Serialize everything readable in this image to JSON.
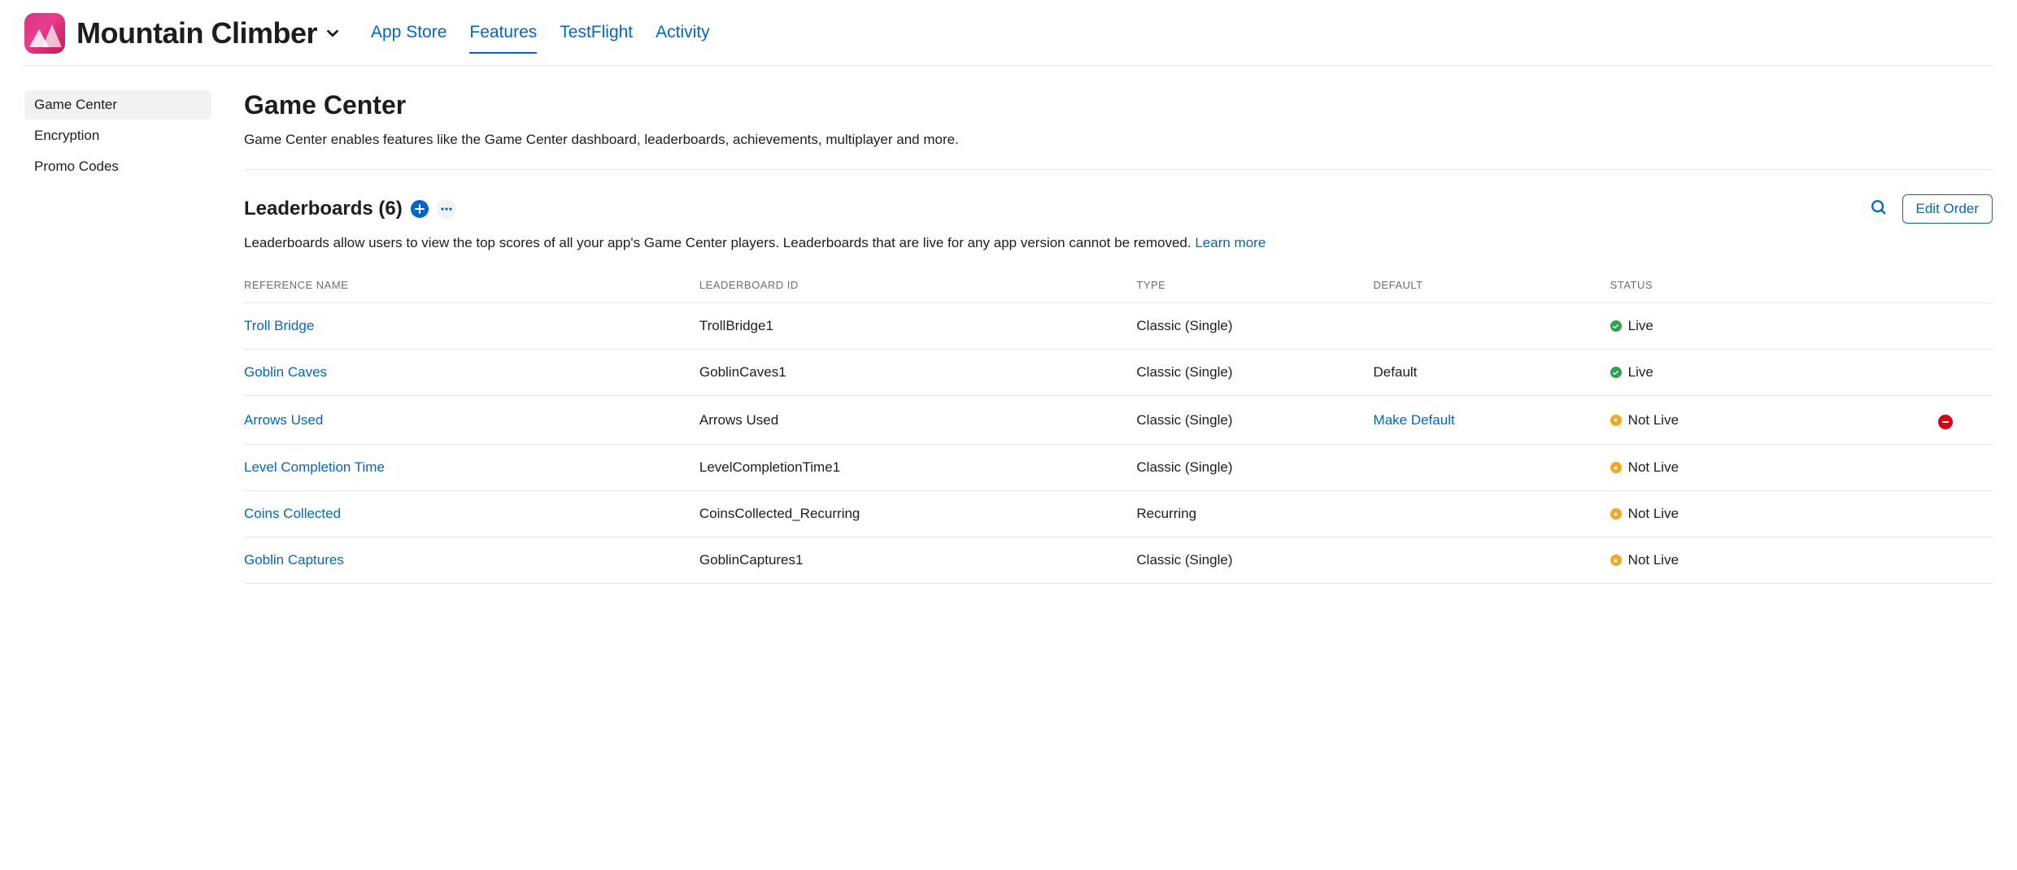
{
  "header": {
    "app_name": "Mountain Climber",
    "tabs": [
      {
        "label": "App Store",
        "active": false
      },
      {
        "label": "Features",
        "active": true
      },
      {
        "label": "TestFlight",
        "active": false
      },
      {
        "label": "Activity",
        "active": false
      }
    ]
  },
  "sidebar": {
    "items": [
      {
        "label": "Game Center",
        "active": true
      },
      {
        "label": "Encryption",
        "active": false
      },
      {
        "label": "Promo Codes",
        "active": false
      }
    ]
  },
  "main": {
    "title": "Game Center",
    "description": "Game Center enables features like the Game Center dashboard, leaderboards, achievements, multiplayer and more.",
    "section": {
      "title": "Leaderboards (6)",
      "edit_order": "Edit Order",
      "description_pre": "Leaderboards allow users to view the top scores of all your app's Game Center players. Leaderboards that are live for any app version cannot be removed. ",
      "learn_more": "Learn more"
    },
    "table": {
      "columns": {
        "reference_name": "REFERENCE NAME",
        "leaderboard_id": "LEADERBOARD ID",
        "type": "TYPE",
        "default": "DEFAULT",
        "status": "STATUS"
      },
      "rows": [
        {
          "reference_name": "Troll Bridge",
          "leaderboard_id": "TrollBridge1",
          "type": "Classic (Single)",
          "default": "",
          "default_link": false,
          "status": "Live",
          "status_color": "green",
          "removable": false
        },
        {
          "reference_name": "Goblin Caves",
          "leaderboard_id": "GoblinCaves1",
          "type": "Classic (Single)",
          "default": "Default",
          "default_link": false,
          "status": "Live",
          "status_color": "green",
          "removable": false
        },
        {
          "reference_name": "Arrows Used",
          "leaderboard_id": "Arrows Used",
          "type": "Classic (Single)",
          "default": "Make Default",
          "default_link": true,
          "status": "Not Live",
          "status_color": "yellow",
          "removable": true
        },
        {
          "reference_name": "Level Completion Time",
          "leaderboard_id": "LevelCompletionTime1",
          "type": "Classic (Single)",
          "default": "",
          "default_link": false,
          "status": "Not Live",
          "status_color": "yellow",
          "removable": false
        },
        {
          "reference_name": "Coins Collected",
          "leaderboard_id": "CoinsCollected_Recurring",
          "type": "Recurring",
          "default": "",
          "default_link": false,
          "status": "Not Live",
          "status_color": "yellow",
          "removable": false
        },
        {
          "reference_name": "Goblin Captures",
          "leaderboard_id": "GoblinCaptures1",
          "type": "Classic (Single)",
          "default": "",
          "default_link": false,
          "status": "Not Live",
          "status_color": "yellow",
          "removable": false
        }
      ]
    }
  }
}
